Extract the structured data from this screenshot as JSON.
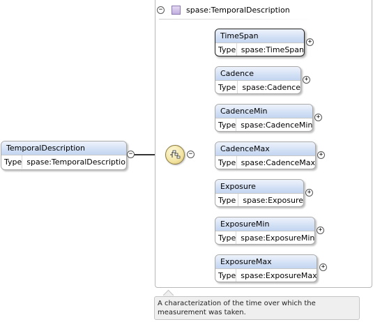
{
  "root": {
    "name": "TemporalDescription",
    "type_label": "Type",
    "type_value": "spase:TemporalDescription"
  },
  "group": {
    "title": "spase:TemporalDescription",
    "collapse_glyph": "⊖"
  },
  "connector": {
    "icon": "sequence-compositor-icon"
  },
  "children": [
    {
      "name": "TimeSpan",
      "type_label": "Type",
      "type_value": "spase:TimeSpan",
      "selected": true
    },
    {
      "name": "Cadence",
      "type_label": "Type",
      "type_value": "spase:Cadence"
    },
    {
      "name": "CadenceMin",
      "type_label": "Type",
      "type_value": "spase:CadenceMin"
    },
    {
      "name": "CadenceMax",
      "type_label": "Type",
      "type_value": "spase:CadenceMax"
    },
    {
      "name": "Exposure",
      "type_label": "Type",
      "type_value": "spase:Exposure"
    },
    {
      "name": "ExposureMin",
      "type_label": "Type",
      "type_value": "spase:ExposureMin"
    },
    {
      "name": "ExposureMax",
      "type_label": "Type",
      "type_value": "spase:ExposureMax"
    }
  ],
  "glyphs": {
    "collapse": "−",
    "expand": "+"
  },
  "annotation": "A characterization of the time over which the measurement was taken."
}
